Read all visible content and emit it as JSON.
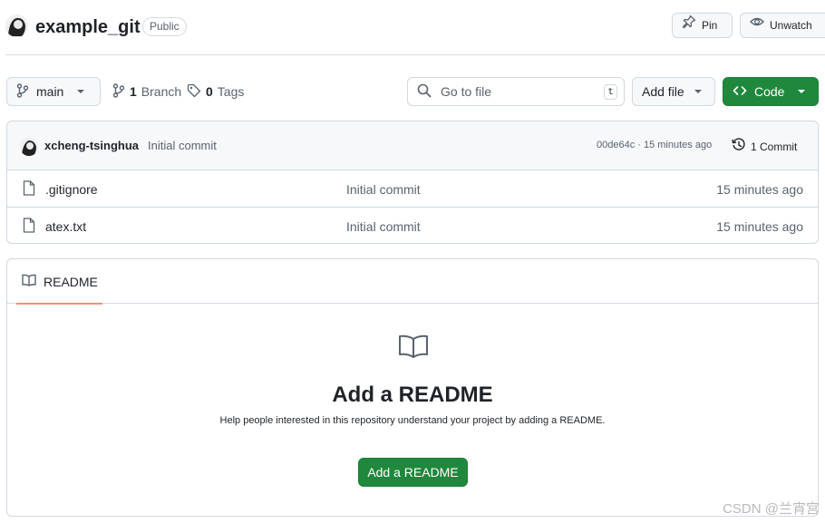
{
  "repo": {
    "name": "example_git",
    "visibility": "Public",
    "pin_label": "Pin",
    "watch_label": "Unwatch"
  },
  "toolbar": {
    "branch": "main",
    "branch_count": "1",
    "branch_label": "Branch",
    "tag_count": "0",
    "tag_label": "Tags",
    "search_placeholder": "Go to file",
    "search_shortcut": "t",
    "add_file_label": "Add file",
    "code_label": "Code"
  },
  "latest_commit": {
    "author": "xcheng-tsinghua",
    "message": "Initial commit",
    "hash_age": "00de64c · 15 minutes ago",
    "commit_count": "1 Commit"
  },
  "files": [
    {
      "name": ".gitignore",
      "message": "Initial commit",
      "age": "15 minutes ago"
    },
    {
      "name": "atex.txt",
      "message": "Initial commit",
      "age": "15 minutes ago"
    }
  ],
  "readme": {
    "tab_label": "README",
    "title": "Add a README",
    "description": "Help people interested in this repository understand your project by adding a README.",
    "button_label": "Add a README"
  },
  "watermark": "CSDN @兰宵宫",
  "colors": {
    "primary_button": "#1f883d",
    "tab_underline": "#fd8c73",
    "border": "#d1d9e0"
  },
  "icons": [
    "avatar",
    "pin-icon",
    "eye-icon",
    "branch-icon",
    "tag-icon",
    "search-icon",
    "code-icon",
    "caret-down-icon",
    "history-icon",
    "file-icon",
    "book-icon"
  ]
}
